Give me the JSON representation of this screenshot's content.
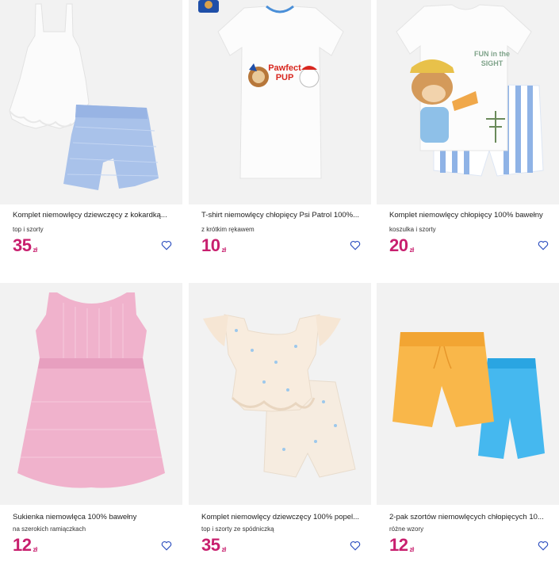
{
  "products": [
    {
      "title": "Komplet niemowlęcy dziewczęcy z kokardką...",
      "subtitle": "top i szorty",
      "price": "35",
      "currency": "zł",
      "image": "white-top-blue-shorts-set"
    },
    {
      "title": "T-shirt niemowlęcy chłopięcy Psi Patrol 100%...",
      "subtitle": "z krótkim rękawem",
      "price": "10",
      "currency": "zł",
      "image": "paw-patrol-tshirt",
      "print_text": "Pawfect PUP"
    },
    {
      "title": "Komplet niemowlęcy chłopięcy 100% bawełny",
      "subtitle": "koszulka i szorty",
      "price": "20",
      "currency": "zł",
      "image": "monkey-tshirt-striped-shorts",
      "print_text": "FUN in the SIGHT"
    },
    {
      "title": "Sukienka niemowlęca 100% bawełny",
      "subtitle": "na szerokich ramiączkach",
      "price": "12",
      "currency": "zł",
      "image": "pink-dress"
    },
    {
      "title": "Komplet niemowlęcy dziewczęcy 100% popel...",
      "subtitle": "top i szorty ze spódniczką",
      "price": "35",
      "currency": "zł",
      "image": "cream-top-skort-set"
    },
    {
      "title": "2-pak szortów niemowlęcych chłopięcych 10...",
      "subtitle": "różne wzory",
      "price": "12",
      "currency": "zł",
      "image": "orange-blue-shorts-2pack"
    }
  ],
  "colors": {
    "price": "#c81f6e",
    "heart": "#2d4fbf",
    "image_bg": "#f2f2f2"
  }
}
